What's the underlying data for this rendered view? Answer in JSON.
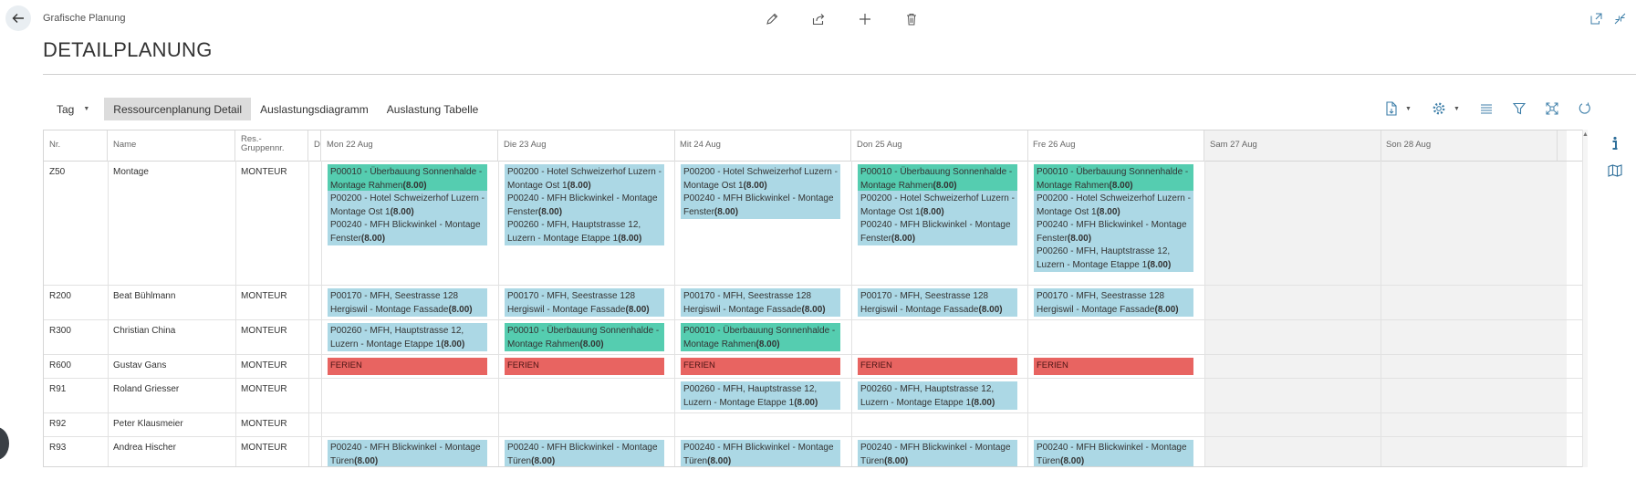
{
  "breadcrumb": "Grafische Planung",
  "title": "DETAILPLANUNG",
  "icons": {
    "back": "arrow-left-icon",
    "edit": "pencil-icon",
    "share": "share-icon",
    "new": "plus-icon",
    "delete": "trash-icon",
    "open_new_window": "open-in-new-window-icon",
    "collapse": "collapse-icon",
    "info": "info-icon",
    "map": "map-icon"
  },
  "tabs": {
    "period": "Tag",
    "items": [
      "Ressourcenplanung Detail",
      "Auslastungsdiagramm",
      "Auslastung Tabelle"
    ],
    "active": "Ressourcenplanung Detail"
  },
  "toolbar": [
    "document-export-icon",
    "settings-gear-icon",
    "list-icon",
    "filter-icon",
    "fit-screen-icon",
    "refresh-icon"
  ],
  "columns": {
    "nr": "Nr.",
    "name": "Name",
    "group_line1": "Res.-",
    "group_line2": "Gruppennr.",
    "d": "D",
    "days": [
      "Mon 22 Aug",
      "Die 23 Aug",
      "Mit 24 Aug",
      "Don 25 Aug",
      "Fre 26 Aug",
      "Sam 27 Aug",
      "Son 28 Aug"
    ]
  },
  "colors": {
    "project_blue": "#acd8e5",
    "project_green": "#55cdb0",
    "vacation_red": "#e86461",
    "weekend_gray": "#f2f2f2"
  },
  "rows": [
    {
      "nr": "Z50",
      "name": "Montage",
      "group": "MONTEUR",
      "days": [
        [
          {
            "c": "green",
            "t": "P00010 - Überbauung Sonnenhalde - Montage Rahmen",
            "h": "(8.00)"
          },
          {
            "c": "blue",
            "t": "P00200 - Hotel Schweizerhof Luzern - Montage Ost 1",
            "h": "(8.00)"
          },
          {
            "c": "blue",
            "t": "P00240 - MFH Blickwinkel - Montage Fenster",
            "h": "(8.00)"
          }
        ],
        [
          {
            "c": "blue",
            "t": "P00200 - Hotel Schweizerhof Luzern - Montage Ost 1",
            "h": "(8.00)"
          },
          {
            "c": "blue",
            "t": "P00240 - MFH Blickwinkel - Montage Fenster",
            "h": "(8.00)"
          },
          {
            "c": "blue",
            "t": "P00260 - MFH, Hauptstrasse 12, Luzern - Montage Etappe 1",
            "h": "(8.00)"
          }
        ],
        [
          {
            "c": "blue",
            "t": "P00200 - Hotel Schweizerhof Luzern - Montage Ost 1",
            "h": "(8.00)"
          },
          {
            "c": "blue",
            "t": "P00240 - MFH Blickwinkel - Montage Fenster",
            "h": "(8.00)"
          }
        ],
        [
          {
            "c": "green",
            "t": "P00010 - Überbauung Sonnenhalde - Montage Rahmen",
            "h": "(8.00)"
          },
          {
            "c": "blue",
            "t": "P00200 - Hotel Schweizerhof Luzern - Montage Ost 1",
            "h": "(8.00)"
          },
          {
            "c": "blue",
            "t": "P00240 - MFH Blickwinkel - Montage Fenster",
            "h": "(8.00)"
          }
        ],
        [
          {
            "c": "green",
            "t": "P00010 - Überbauung Sonnenhalde - Montage Rahmen",
            "h": "(8.00)"
          },
          {
            "c": "blue",
            "t": "P00200 - Hotel Schweizerhof Luzern - Montage Ost 1",
            "h": "(8.00)"
          },
          {
            "c": "blue",
            "t": "P00240 - MFH Blickwinkel - Montage Fenster",
            "h": "(8.00)"
          },
          {
            "c": "blue",
            "t": "P00260 - MFH, Hauptstrasse 12, Luzern - Montage Etappe 1",
            "h": "(8.00)"
          }
        ],
        [],
        []
      ]
    },
    {
      "nr": "R200",
      "name": "Beat Bühlmann",
      "group": "MONTEUR",
      "days": [
        [
          {
            "c": "blue",
            "t": "P00170 - MFH, Seestrasse 128 Hergiswil - Montage Fassade",
            "h": "(8.00)"
          }
        ],
        [
          {
            "c": "blue",
            "t": "P00170 - MFH, Seestrasse 128 Hergiswil - Montage Fassade",
            "h": "(8.00)"
          }
        ],
        [
          {
            "c": "blue",
            "t": "P00170 - MFH, Seestrasse 128 Hergiswil - Montage Fassade",
            "h": "(8.00)"
          }
        ],
        [
          {
            "c": "blue",
            "t": "P00170 - MFH, Seestrasse 128 Hergiswil - Montage Fassade",
            "h": "(8.00)"
          }
        ],
        [
          {
            "c": "blue",
            "t": "P00170 - MFH, Seestrasse 128 Hergiswil - Montage Fassade",
            "h": "(8.00)"
          }
        ],
        [],
        []
      ]
    },
    {
      "nr": "R300",
      "name": "Christian China",
      "group": "MONTEUR",
      "days": [
        [
          {
            "c": "blue",
            "t": "P00260 - MFH, Hauptstrasse 12, Luzern - Montage Etappe 1",
            "h": "(8.00)"
          }
        ],
        [
          {
            "c": "green",
            "t": "P00010 - Überbauung Sonnenhalde - Montage Rahmen",
            "h": "(8.00)"
          }
        ],
        [
          {
            "c": "green",
            "t": "P00010 - Überbauung Sonnenhalde - Montage Rahmen",
            "h": "(8.00)"
          }
        ],
        [],
        [],
        [],
        []
      ]
    },
    {
      "nr": "R600",
      "name": "Gustav Gans",
      "group": "MONTEUR",
      "days": [
        [
          {
            "c": "red",
            "t": "FERIEN",
            "h": ""
          }
        ],
        [
          {
            "c": "red",
            "t": "FERIEN",
            "h": ""
          }
        ],
        [
          {
            "c": "red",
            "t": "FERIEN",
            "h": ""
          }
        ],
        [
          {
            "c": "red",
            "t": "FERIEN",
            "h": ""
          }
        ],
        [
          {
            "c": "red",
            "t": "FERIEN",
            "h": ""
          }
        ],
        [],
        []
      ]
    },
    {
      "nr": "R91",
      "name": "Roland Griesser",
      "group": "MONTEUR",
      "days": [
        [],
        [],
        [
          {
            "c": "blue",
            "t": "P00260 - MFH, Hauptstrasse 12, Luzern - Montage Etappe 1",
            "h": "(8.00)"
          }
        ],
        [
          {
            "c": "blue",
            "t": "P00260 - MFH, Hauptstrasse 12, Luzern - Montage Etappe 1",
            "h": "(8.00)"
          }
        ],
        [],
        [],
        []
      ]
    },
    {
      "nr": "R92",
      "name": "Peter Klausmeier",
      "group": "MONTEUR",
      "days": [
        [],
        [],
        [],
        [],
        [],
        [],
        []
      ]
    },
    {
      "nr": "R93",
      "name": "Andrea Hischer",
      "group": "MONTEUR",
      "days": [
        [
          {
            "c": "blue",
            "t": "P00240 - MFH Blickwinkel - Montage Türen",
            "h": "(8.00)"
          }
        ],
        [
          {
            "c": "blue",
            "t": "P00240 - MFH Blickwinkel - Montage Türen",
            "h": "(8.00)"
          }
        ],
        [
          {
            "c": "blue",
            "t": "P00240 - MFH Blickwinkel - Montage Türen",
            "h": "(8.00)"
          }
        ],
        [
          {
            "c": "blue",
            "t": "P00240 - MFH Blickwinkel - Montage Türen",
            "h": "(8.00)"
          }
        ],
        [
          {
            "c": "blue",
            "t": "P00240 - MFH Blickwinkel - Montage Türen",
            "h": "(8.00)"
          }
        ],
        [],
        []
      ]
    }
  ]
}
